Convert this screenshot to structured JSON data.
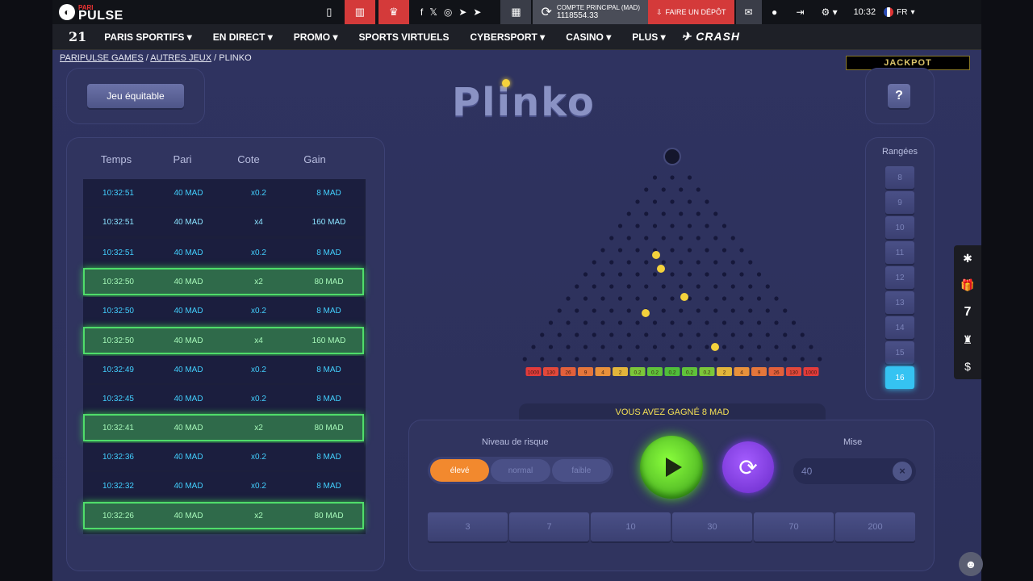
{
  "topbar": {
    "brand_small": "PARI",
    "brand_large": "PULSE",
    "account_label": "COMPTE PRINCIPAL (MAD)",
    "balance": "1118554.33",
    "deposit_label": "FAIRE UN DÉPÔT",
    "time": "10:32",
    "lang": "FR"
  },
  "nav": {
    "logo": "21",
    "items": [
      "PARIS SPORTIFS",
      "EN DIRECT",
      "PROMO",
      "SPORTS VIRTUELS",
      "CYBERSPORT",
      "CASINO",
      "PLUS"
    ],
    "crash": "CRASH"
  },
  "breadcrumb": [
    "PARIPULSE GAMES",
    "AUTRES JEUX",
    "PLINKO"
  ],
  "jackpot": "JACKPOT",
  "game": {
    "title": "Plinko",
    "fair_button": "Jeu équitable",
    "help_button": "?",
    "win_message": "VOUS AVEZ GAGNÉ 8 MAD"
  },
  "history": {
    "headers": [
      "Temps",
      "Pari",
      "Cote",
      "Gain"
    ],
    "rows": [
      {
        "time": "10:32:51",
        "bet": "40 MAD",
        "odds": "x0.2",
        "win": "8 MAD",
        "won": false
      },
      {
        "time": "10:32:51",
        "bet": "40 MAD",
        "odds": "x4",
        "win": "160 MAD",
        "won": false
      },
      {
        "time": "10:32:51",
        "bet": "40 MAD",
        "odds": "x0.2",
        "win": "8 MAD",
        "won": false
      },
      {
        "time": "10:32:50",
        "bet": "40 MAD",
        "odds": "x2",
        "win": "80 MAD",
        "won": true
      },
      {
        "time": "10:32:50",
        "bet": "40 MAD",
        "odds": "x0.2",
        "win": "8 MAD",
        "won": false
      },
      {
        "time": "10:32:50",
        "bet": "40 MAD",
        "odds": "x4",
        "win": "160 MAD",
        "won": true
      },
      {
        "time": "10:32:49",
        "bet": "40 MAD",
        "odds": "x0.2",
        "win": "8 MAD",
        "won": false
      },
      {
        "time": "10:32:45",
        "bet": "40 MAD",
        "odds": "x0.2",
        "win": "8 MAD",
        "won": false
      },
      {
        "time": "10:32:41",
        "bet": "40 MAD",
        "odds": "x2",
        "win": "80 MAD",
        "won": true
      },
      {
        "time": "10:32:36",
        "bet": "40 MAD",
        "odds": "x0.2",
        "win": "8 MAD",
        "won": false
      },
      {
        "time": "10:32:32",
        "bet": "40 MAD",
        "odds": "x0.2",
        "win": "8 MAD",
        "won": false
      },
      {
        "time": "10:32:26",
        "bet": "40 MAD",
        "odds": "x2",
        "win": "80 MAD",
        "won": true
      }
    ]
  },
  "board": {
    "rows": 16,
    "multipliers": [
      "1000",
      "130",
      "26",
      "9",
      "4",
      "2",
      "0.2",
      "0.2",
      "0.2",
      "0.2",
      "0.2",
      "2",
      "4",
      "9",
      "26",
      "130",
      "1000"
    ],
    "multiplier_colors": [
      "#e23b3b",
      "#e2483b",
      "#e2603b",
      "#e4763b",
      "#e8913b",
      "#e2b53b",
      "#7bc63a",
      "#5fc23a",
      "#4fbf3a",
      "#5fc23a",
      "#7bc63a",
      "#e2b53b",
      "#e8913b",
      "#e4763b",
      "#e2603b",
      "#e2483b",
      "#e23b3b"
    ]
  },
  "rows_selector": {
    "label": "Rangées",
    "options": [
      "8",
      "9",
      "10",
      "11",
      "12",
      "13",
      "14",
      "15",
      "16"
    ],
    "selected": "16"
  },
  "controls": {
    "risk_label": "Niveau de risque",
    "risk_options": [
      "élevé",
      "normal",
      "faible"
    ],
    "risk_selected": "élevé",
    "stake_label": "Mise",
    "stake_value": "40",
    "clear": "×",
    "chips": [
      "3",
      "7",
      "10",
      "30",
      "70",
      "200"
    ]
  }
}
